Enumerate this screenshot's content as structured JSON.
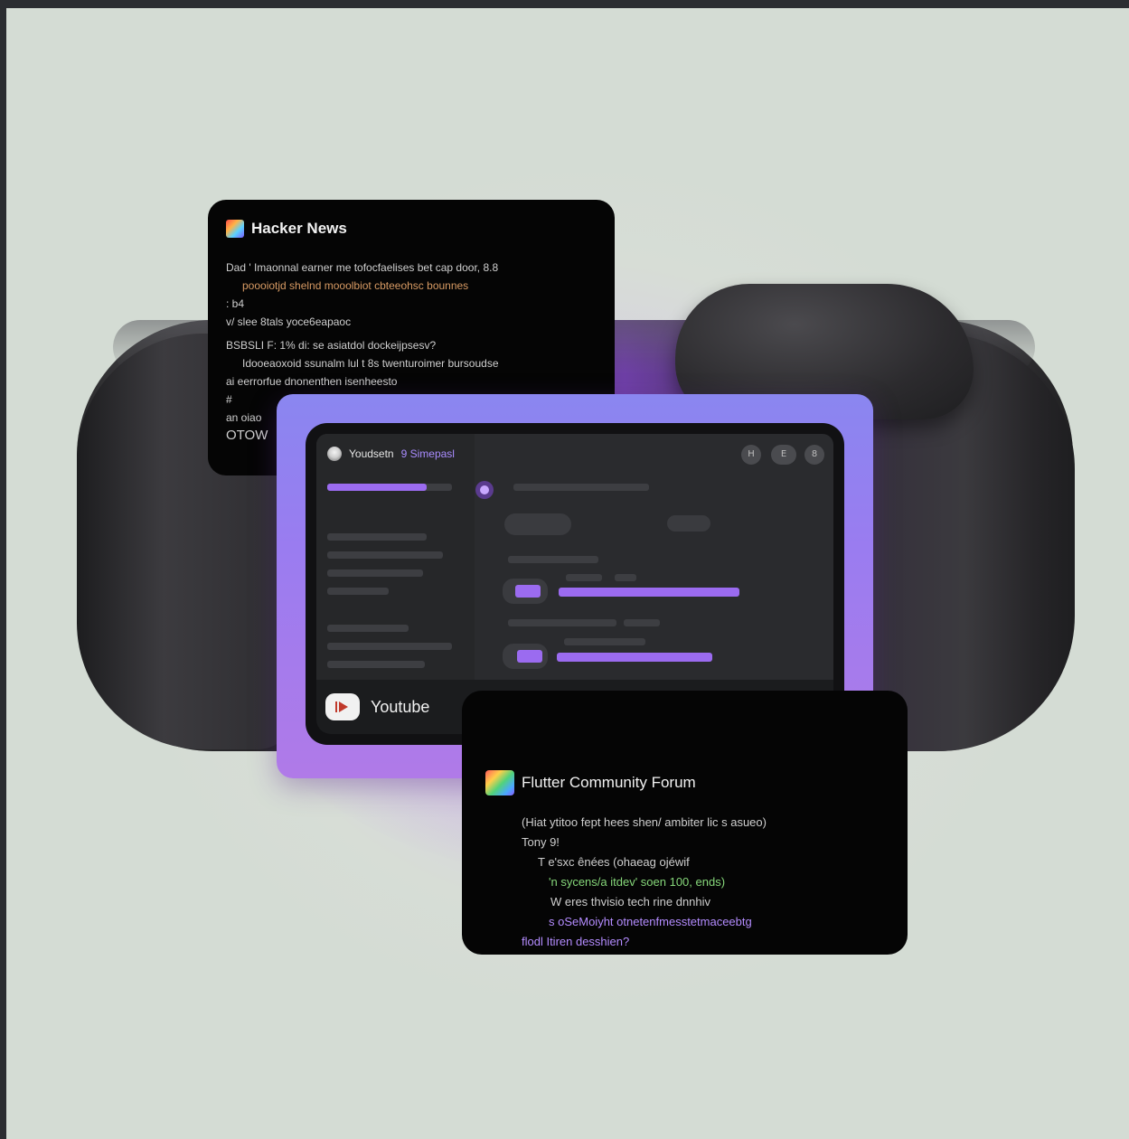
{
  "hacker_news": {
    "title": "Hacker News",
    "lines": [
      "Dad ' Imaonnal earner me tofocfaelises bet cap door, 8.8",
      "poooiotjd shelnd  mooolbiot cbteeohsc bounnes",
      ": b4",
      "v/ slee 8tals yoce6eapaoc",
      "BSBSLI F: 1% di: se asiatdol dockeijpsesv?",
      "Idooeaoxoid ssunalm lul t 8s twenturoimer bursoudse",
      "ai eerrorfue dnonenthen isenheesto",
      "#",
      "an oiao",
      "OTOW"
    ]
  },
  "youtube_window": {
    "header_name": "Youdsetn",
    "header_link": "9 Simepasl",
    "footer_label": "Youtube",
    "controls": [
      "H",
      "E",
      "8"
    ],
    "accent": "#9b6bf0"
  },
  "flutter_forum": {
    "title": "Flutter Community Forum",
    "lines": [
      "(Hiat ytitoo fept hees shen/ ambiter lic s asueo)",
      "Tony 9!",
      "T e'sxc ênées (ohaeag ojéwif",
      "'n sycens/a itdev' soen 100, ends)",
      "W eres thvisio tech rine dnnhiv",
      "s  oSeMoiyht otnetenfmesstetmaceebtg",
      "flodl Itiren desshien?"
    ]
  },
  "colors": {
    "background": "#d4dcd4",
    "card": "#050505",
    "accent_purple": "#9b6bf0",
    "frame_purple": "#9a7cf0"
  }
}
